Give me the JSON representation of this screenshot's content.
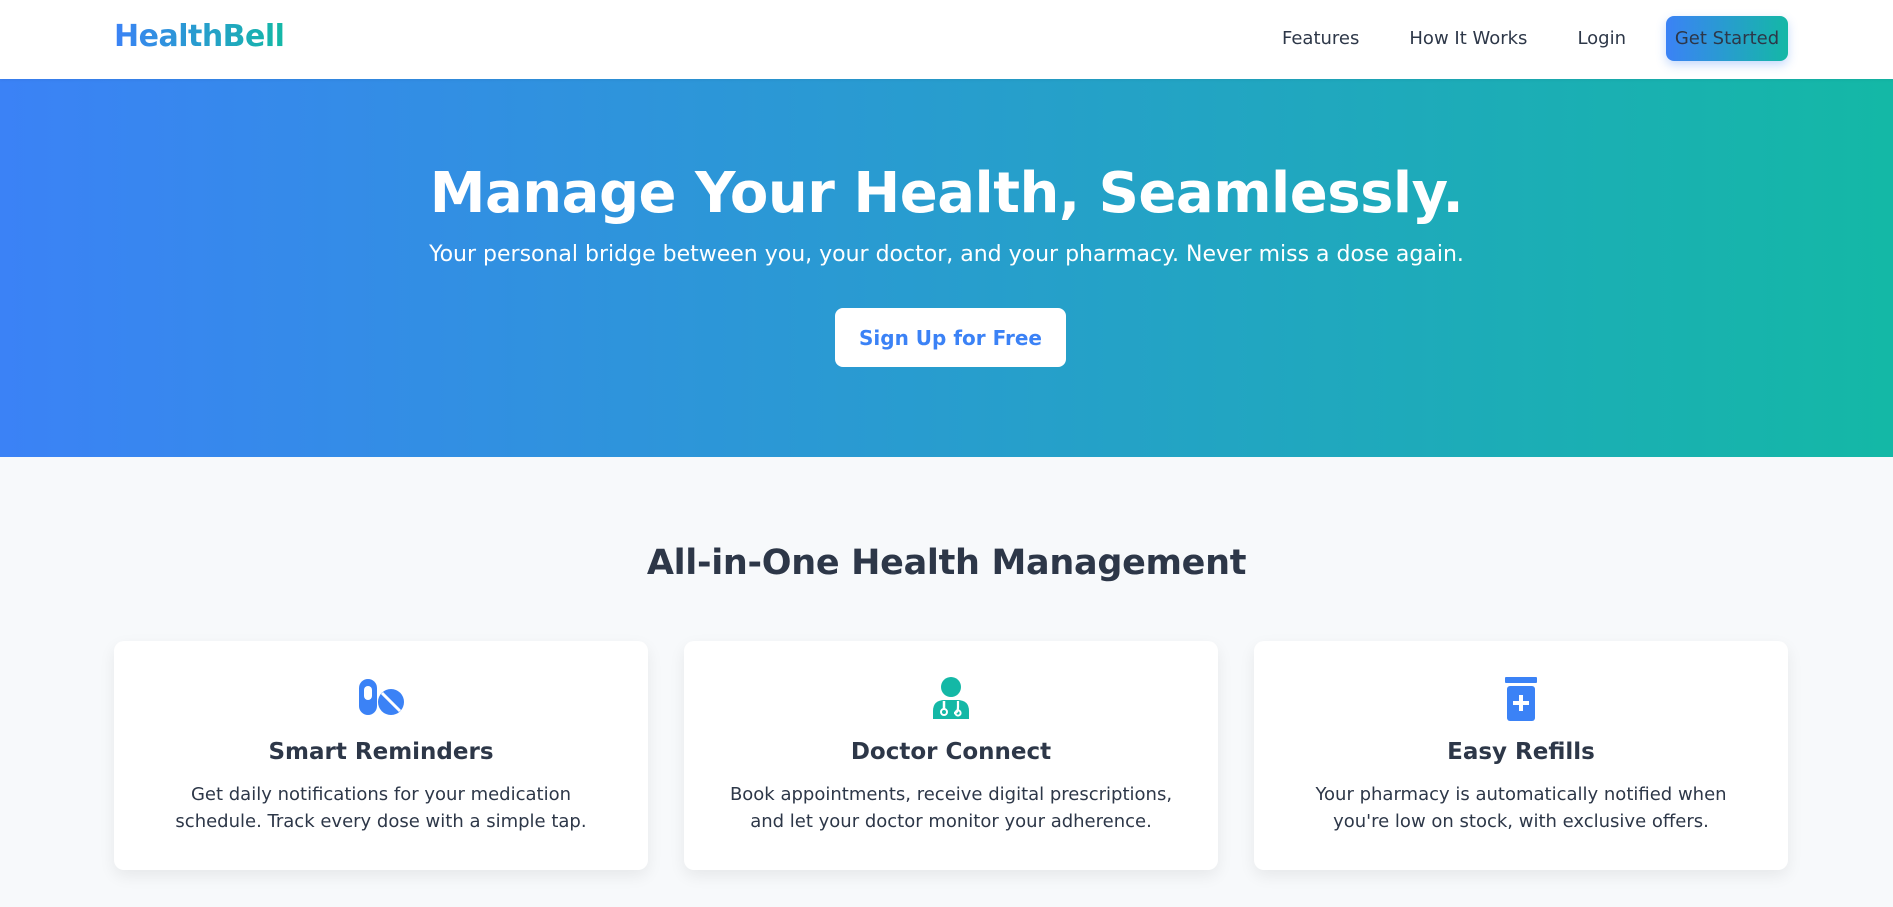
{
  "brand": {
    "name": "HealthBell"
  },
  "nav": {
    "links": [
      "Features",
      "How It Works",
      "Login"
    ],
    "cta": "Get Started"
  },
  "hero": {
    "title": "Manage Your Health, Seamlessly.",
    "subtitle": "Your personal bridge between you, your doctor, and your pharmacy. Never miss a dose again.",
    "button": "Sign Up for Free"
  },
  "features": {
    "title": "All-in-One Health Management",
    "cards": [
      {
        "icon": "pills-icon",
        "title": "Smart Reminders",
        "desc": "Get daily notifications for your medication schedule. Track every dose with a simple tap."
      },
      {
        "icon": "doctor-icon",
        "title": "Doctor Connect",
        "desc": "Book appointments, receive digital prescriptions, and let your doctor monitor your adherence."
      },
      {
        "icon": "prescription-bottle-icon",
        "title": "Easy Refills",
        "desc": "Your pharmacy is automatically notified when you're low on stock, with exclusive offers."
      }
    ]
  },
  "colors": {
    "gradient_start": "#3b82f6",
    "gradient_end": "#14b8a6",
    "text": "#2d3748",
    "background": "#f7f9fb"
  }
}
